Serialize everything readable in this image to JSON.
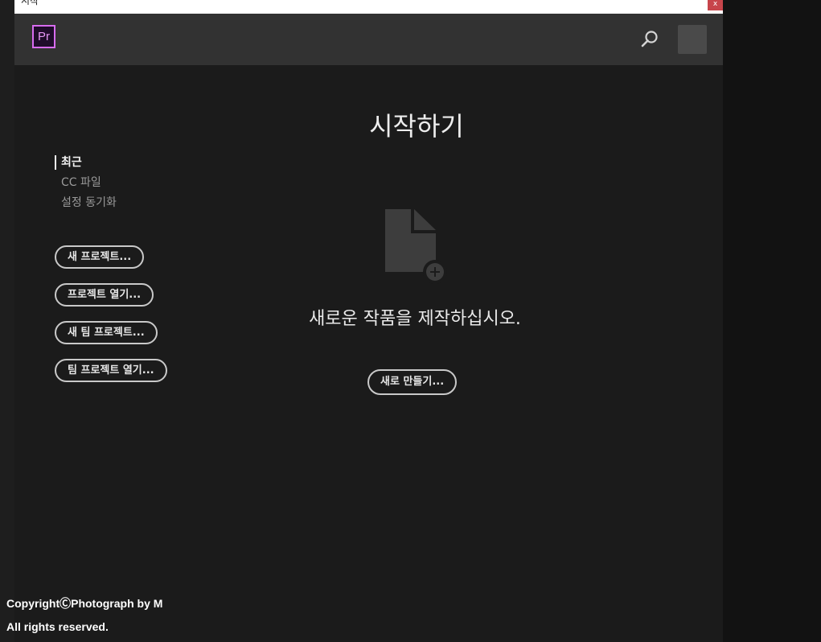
{
  "window": {
    "title": "시작",
    "close_label": "x"
  },
  "appbar": {
    "logo_text": "Pr",
    "search_icon": "search-icon",
    "avatar_icon": "avatar"
  },
  "page": {
    "title": "시작하기"
  },
  "nav": {
    "items": [
      {
        "label": "최근",
        "active": true
      },
      {
        "label": "CC 파일",
        "active": false
      },
      {
        "label": "설정 동기화",
        "active": false
      }
    ]
  },
  "actions": {
    "new_project": "새 프로젝트...",
    "open_project": "프로젝트 열기...",
    "new_team_project": "새 팀 프로젝트...",
    "open_team_project": "팀 프로젝트 열기..."
  },
  "empty_state": {
    "icon": "new-file-icon",
    "message": "새로운 작품을 제작하십시오.",
    "button": "새로 만들기..."
  },
  "watermark": {
    "line1": "CopyrightⒸPhotograph by M",
    "line2": "All rights reserved."
  },
  "colors": {
    "app_bg": "#1b1b1b",
    "appbar_bg": "#323232",
    "accent_purple": "#d86cf0",
    "close_red": "#c7454b"
  }
}
